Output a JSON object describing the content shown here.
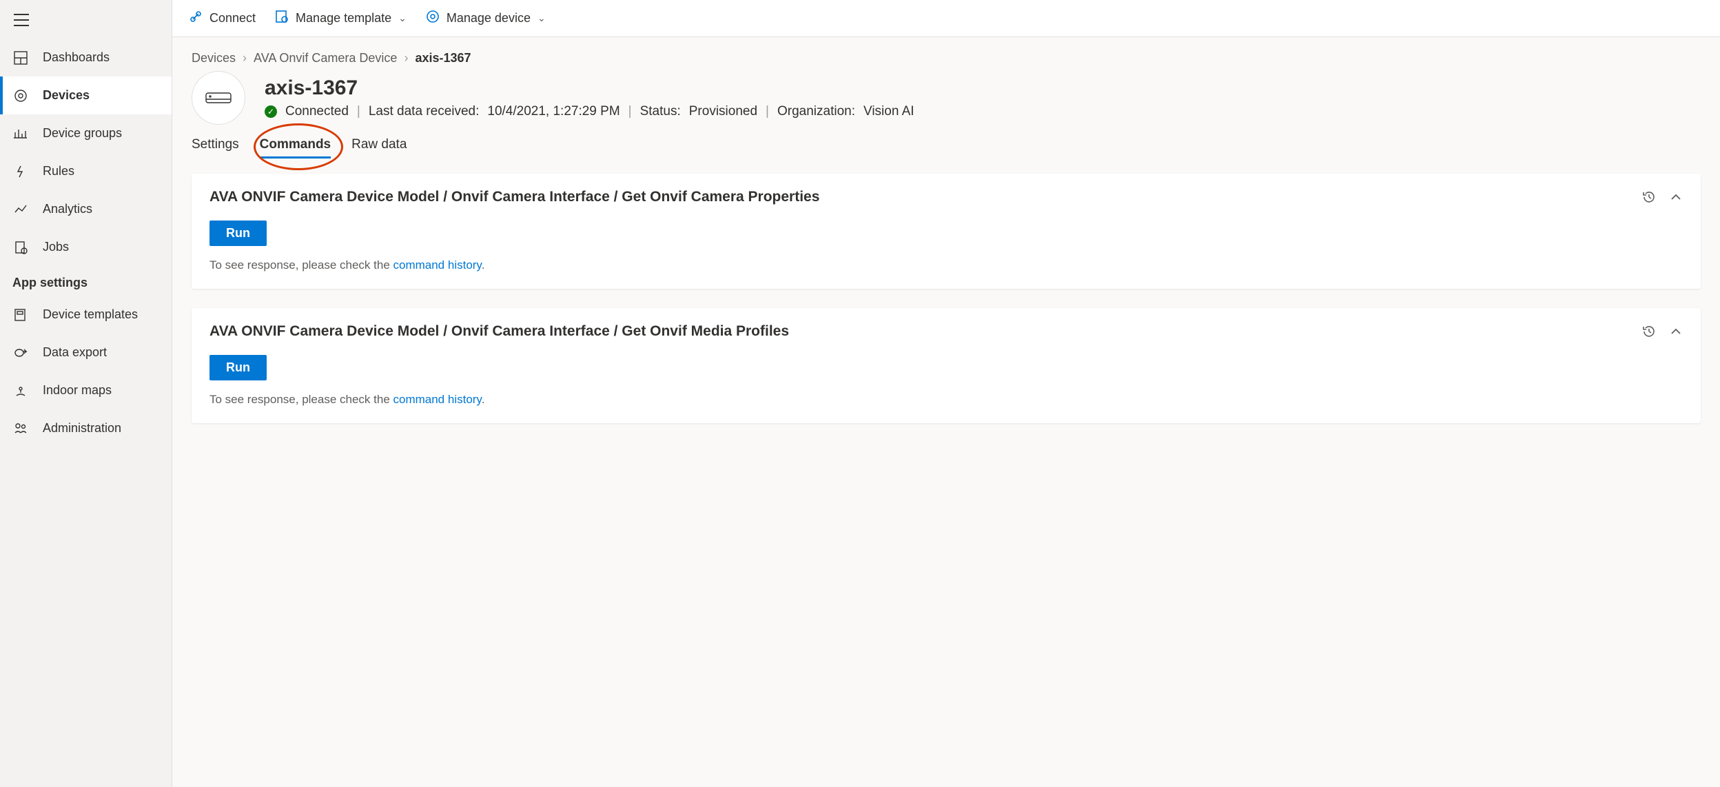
{
  "sidebar": {
    "items": [
      {
        "label": "Dashboards"
      },
      {
        "label": "Devices"
      },
      {
        "label": "Device groups"
      },
      {
        "label": "Rules"
      },
      {
        "label": "Analytics"
      },
      {
        "label": "Jobs"
      }
    ],
    "section_header": "App settings",
    "app_items": [
      {
        "label": "Device templates"
      },
      {
        "label": "Data export"
      },
      {
        "label": "Indoor maps"
      },
      {
        "label": "Administration"
      }
    ]
  },
  "toolbar": {
    "connect": "Connect",
    "manage_template": "Manage template",
    "manage_device": "Manage device"
  },
  "breadcrumb": {
    "a": "Devices",
    "b": "AVA Onvif Camera Device",
    "c": "axis-1367"
  },
  "device": {
    "title": "axis-1367",
    "status_connected": "Connected",
    "last_data_label": "Last data received:",
    "last_data_value": "10/4/2021, 1:27:29 PM",
    "status_label": "Status:",
    "status_value": "Provisioned",
    "org_label": "Organization:",
    "org_value": "Vision AI"
  },
  "tabs": {
    "settings": "Settings",
    "commands": "Commands",
    "raw": "Raw data"
  },
  "cards": [
    {
      "title": "AVA ONVIF Camera Device Model / Onvif Camera Interface / Get Onvif Camera Properties",
      "run": "Run",
      "hint_prefix": "To see response, please check the ",
      "hint_link": "command history",
      "hint_suffix": "."
    },
    {
      "title": "AVA ONVIF Camera Device Model / Onvif Camera Interface / Get Onvif Media Profiles",
      "run": "Run",
      "hint_prefix": "To see response, please check the ",
      "hint_link": "command history",
      "hint_suffix": "."
    }
  ]
}
